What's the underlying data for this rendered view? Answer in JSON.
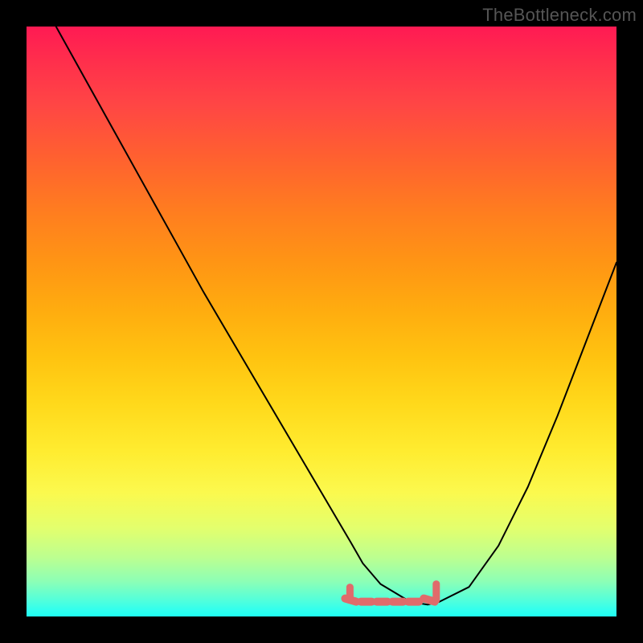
{
  "watermark": "TheBottleneck.com",
  "chart_data": {
    "type": "line",
    "title": "",
    "xlabel": "",
    "ylabel": "",
    "xlim": [
      0,
      100
    ],
    "ylim": [
      0,
      100
    ],
    "grid": false,
    "legend": false,
    "series": [
      {
        "name": "curve",
        "color": "#000000",
        "x": [
          5,
          10,
          15,
          20,
          25,
          30,
          35,
          40,
          45,
          50,
          55,
          57,
          60,
          65,
          68,
          70,
          75,
          80,
          85,
          90,
          95,
          100
        ],
        "values": [
          100,
          91,
          82,
          73,
          64,
          55,
          46.5,
          38,
          29.5,
          21,
          12.5,
          9,
          5.5,
          2.5,
          2,
          2.5,
          5,
          12,
          22,
          34,
          47,
          60
        ]
      }
    ],
    "highlight": {
      "name": "optimal-zone",
      "color": "#e06b6b",
      "x_range": [
        54,
        70
      ],
      "y": 2.5
    }
  }
}
